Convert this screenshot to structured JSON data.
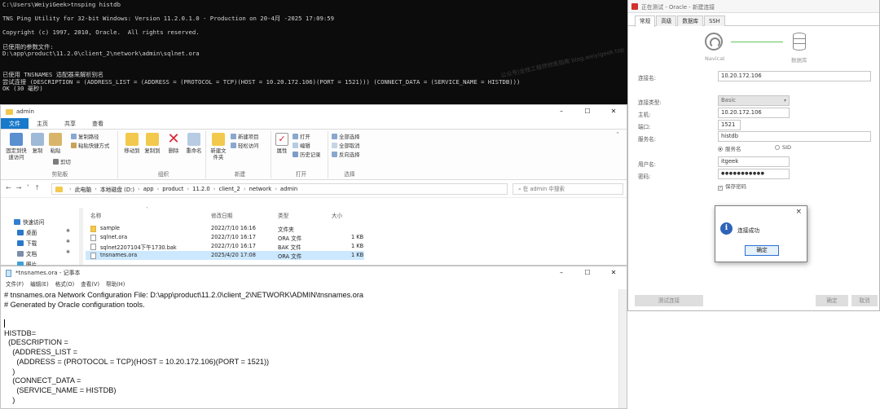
{
  "console": {
    "lines": [
      "C:\\Users\\WeiyiGeek>tnsping histdb",
      "",
      "TNS Ping Utility for 32-bit Windows: Version 11.2.0.1.0 - Production on 20-4月 -2025 17:09:59",
      "",
      "Copyright (c) 1997, 2010, Oracle.  All rights reserved.",
      "",
      "已使用的参数文件:",
      "D:\\app\\product\\11.2.0\\client_2\\network\\admin\\sqlnet.ora",
      "",
      "",
      "已使用 TNSNAMES 适配器来解析别名",
      "尝试连接 (DESCRIPTION = (ADDRESS_LIST = (ADDRESS = (PROTOCOL = TCP)(HOST = 10.20.172.106)(PORT = 1521))) (CONNECT_DATA = (SERVICE_NAME = HISTDB)))",
      "OK (30 毫秒)"
    ],
    "watermark": "公众号|全栈工程师修炼指南 blog.weiyigeek.top"
  },
  "oracle_dialog": {
    "title": "正在测试 - Oracle - 新建连接",
    "tabs": [
      "常规",
      "高级",
      "数据库",
      "SSH"
    ],
    "diagram": {
      "left_label": "Navicat",
      "right_label": "数据库"
    },
    "connection_name_label": "连接名:",
    "connection_name": "10.20.172.106",
    "connection_type_label": "连接类型:",
    "connection_type": "Basic",
    "host_label": "主机:",
    "host": "10.20.172.106",
    "port_label": "端口:",
    "port": "1521",
    "service_label": "服务名:",
    "service": "histdb",
    "radio_service": "服务名",
    "radio_sid": "SID",
    "user_label": "用户名:",
    "user": "itgeek",
    "password_label": "密码:",
    "password": "●●●●●●●●●●●",
    "save_password": "保存密码",
    "test_button": "测试连接",
    "ok_button": "确定",
    "cancel_button": "取消"
  },
  "popup": {
    "message": "连接成功",
    "ok": "确定",
    "close": "×"
  },
  "explorer": {
    "title": "admin",
    "window_controls": [
      "–",
      "☐",
      "✕"
    ],
    "ribbon_tabs": [
      "文件",
      "主页",
      "共享",
      "查看"
    ],
    "ribbon": {
      "clipboard": {
        "pin": "固定到快速访问",
        "copy": "复制",
        "paste": "粘贴",
        "copy_path": "复制路径",
        "paste_shortcut": "粘贴快捷方式",
        "cut": "剪切",
        "group": "剪贴板"
      },
      "organize": {
        "move_to": "移动到",
        "copy_to": "复制到",
        "delete": "删除",
        "rename": "重命名",
        "group": "组织"
      },
      "new": {
        "new_folder": "新建文件夹",
        "new_item": "新建项目",
        "easy_access": "轻松访问",
        "group": "新建"
      },
      "open": {
        "properties": "属性",
        "open": "打开",
        "edit": "编辑",
        "history": "历史记录",
        "group": "打开"
      },
      "select": {
        "select_all": "全部选择",
        "select_none": "全部取消",
        "invert": "反向选择",
        "group": "选择"
      }
    },
    "breadcrumb": [
      "此电脑",
      "本地磁盘 (D:)",
      "app",
      "product",
      "11.2.0",
      "client_2",
      "network",
      "admin"
    ],
    "search_placeholder": "在 admin 中搜索",
    "nav": [
      {
        "label": "快速访问"
      },
      {
        "label": "桌面"
      },
      {
        "label": "下载"
      },
      {
        "label": "文档"
      },
      {
        "label": "图片"
      }
    ],
    "columns": [
      "名称",
      "修改日期",
      "类型",
      "大小"
    ],
    "files": [
      {
        "name": "sample",
        "date": "2022/7/10 16:16",
        "type": "文件夹",
        "size": ""
      },
      {
        "name": "sqlnet.ora",
        "date": "2022/7/10 16:17",
        "type": "ORA 文件",
        "size": "1 KB"
      },
      {
        "name": "sqlnet2207104下午1730.bak",
        "date": "2022/7/10 16:17",
        "type": "BAK 文件",
        "size": "1 KB"
      },
      {
        "name": "tnsnames.ora",
        "date": "2025/4/20 17:08",
        "type": "ORA 文件",
        "size": "1 KB"
      }
    ]
  },
  "notepad": {
    "title": "*tnsnames.ora - 记事本",
    "menu": [
      "文件(F)",
      "编辑(E)",
      "格式(O)",
      "查看(V)",
      "帮助(H)"
    ],
    "lines": [
      "# tnsnames.ora Network Configuration File: D:\\app\\product\\11.2.0\\client_2\\NETWORK\\ADMIN\\tnsnames.ora",
      "# Generated by Oracle configuration tools.",
      "",
      "",
      "HISTDB=",
      "  (DESCRIPTION =",
      "    (ADDRESS_LIST =",
      "      (ADDRESS = (PROTOCOL = TCP)(HOST = 10.20.172.106)(PORT = 1521))",
      "    )",
      "    (CONNECT_DATA =",
      "      (SERVICE_NAME = HISTDB)",
      "    )"
    ]
  }
}
